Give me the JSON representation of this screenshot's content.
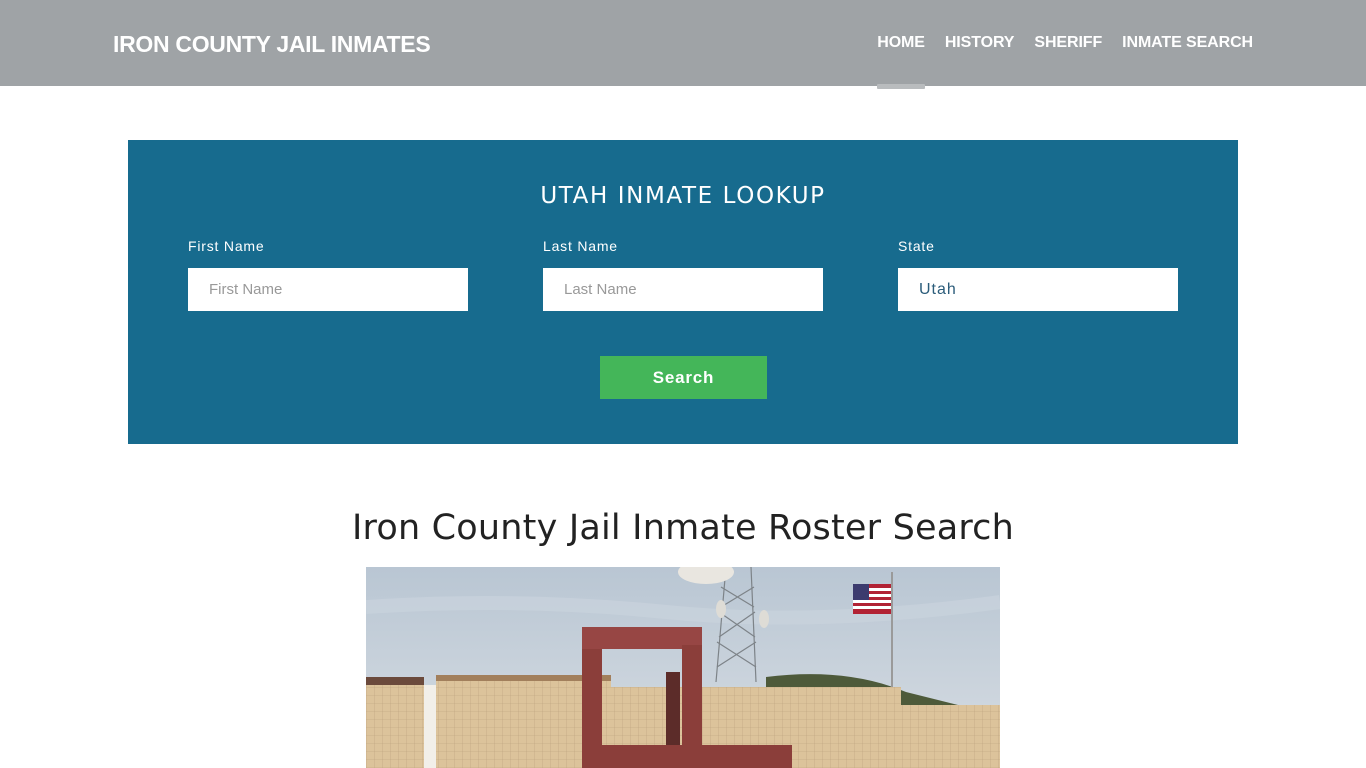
{
  "header": {
    "brand": "IRON COUNTY JAIL INMATES",
    "nav": [
      {
        "label": "HOME",
        "active": true
      },
      {
        "label": "HISTORY",
        "active": false
      },
      {
        "label": "SHERIFF",
        "active": false
      },
      {
        "label": "INMATE SEARCH",
        "active": false
      }
    ]
  },
  "lookup": {
    "title": "UTAH INMATE LOOKUP",
    "first_name": {
      "label": "First Name",
      "placeholder": "First Name",
      "value": ""
    },
    "last_name": {
      "label": "Last Name",
      "placeholder": "Last Name",
      "value": ""
    },
    "state": {
      "label": "State",
      "value": "Utah"
    },
    "search_label": "Search"
  },
  "main": {
    "title": "Iron County Jail Inmate Roster Search",
    "image_alt": "Iron County Jail building with radio tower and American flag"
  },
  "colors": {
    "header_bg": "#9fa3a6",
    "lookup_bg": "#176b8e",
    "search_button": "#44b659"
  }
}
